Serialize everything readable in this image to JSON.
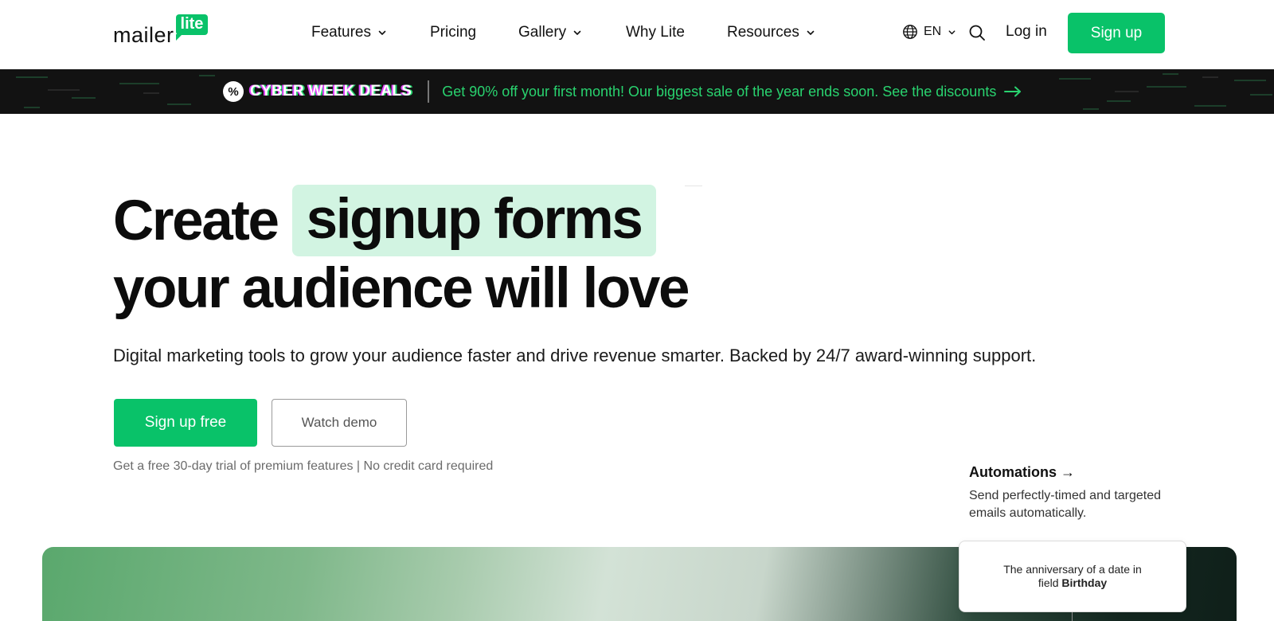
{
  "header": {
    "logo_word": "mailer",
    "logo_badge": "lite",
    "nav": [
      {
        "label": "Features",
        "has_dropdown": true
      },
      {
        "label": "Pricing",
        "has_dropdown": false
      },
      {
        "label": "Gallery",
        "has_dropdown": true
      },
      {
        "label": "Why Lite",
        "has_dropdown": false
      },
      {
        "label": "Resources",
        "has_dropdown": true
      }
    ],
    "language": "EN",
    "login_label": "Log in",
    "signup_label": "Sign up"
  },
  "promo": {
    "badge_symbol": "%",
    "title": "CYBER WEEK DEALS",
    "text": "Get 90% off your first month! Our biggest sale of the year ends soon. See the discounts"
  },
  "hero": {
    "word1": "Create",
    "highlight": "signup forms",
    "line2": "your audience will love",
    "subtitle": "Digital marketing tools to grow your audience faster and drive revenue smarter. Backed by 24/7 award-winning support.",
    "primary_cta": "Sign up free",
    "secondary_cta": "Watch demo",
    "trial_note": "Get a free 30-day trial of premium features | No credit card required"
  },
  "feature_card": {
    "title": "Automations →",
    "description": "Send perfectly-timed and targeted emails automatically."
  },
  "popup": {
    "line1": "The anniversary of a date in",
    "prefix": "field ",
    "field": "Birthday"
  },
  "colors": {
    "brand_green": "#09c269",
    "highlight_bg": "#d2f4e2",
    "promo_bg": "#121212",
    "promo_text": "#29d36f"
  }
}
